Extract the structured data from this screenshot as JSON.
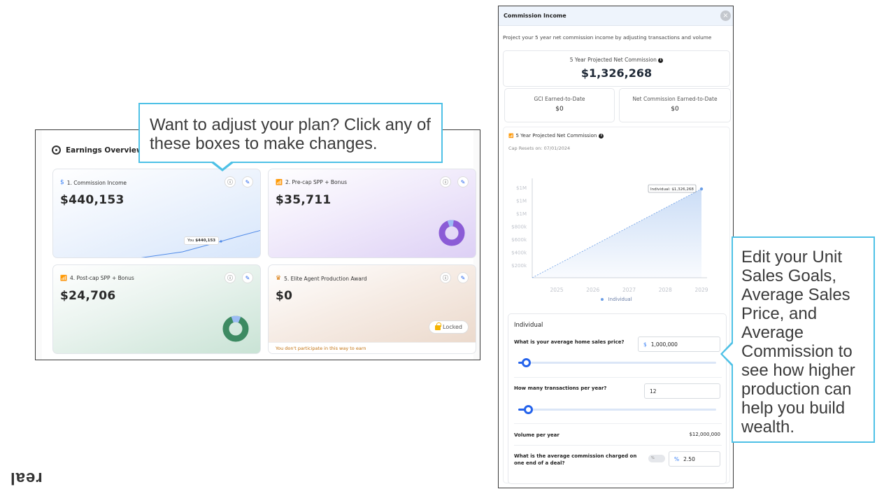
{
  "earnings": {
    "title": "Earnings Overview",
    "cards": [
      {
        "label": "1. Commission Income",
        "value": "$440,153",
        "you_label": "You",
        "you_value": "$440,153"
      },
      {
        "label": "2. Pre-cap SPP + Bonus",
        "value": "$35,711"
      },
      {
        "label": "4. Post-cap SPP + Bonus",
        "value": "$24,706"
      },
      {
        "label": "5. Elite Agent Production Award",
        "value": "$0",
        "locked_label": "Locked",
        "note": "You don't participate in this way to earn"
      }
    ],
    "donuts": [
      {
        "fill_fraction": 0.08,
        "main_color": "#8b5cd6",
        "slice_color": "#9cbcf4"
      },
      {
        "fill_fraction": 0.12,
        "main_color": "#3d8a62",
        "slice_color": "#9cbcf4"
      }
    ]
  },
  "callouts": {
    "top": "Want to adjust your plan? Click any of these boxes to make changes.",
    "right": "Edit your Unit Sales Goals, Average Sales Price, and Average Commission to see how higher production can help you build wealth."
  },
  "panel": {
    "title": "Commission Income",
    "close_icon": "×",
    "subtitle": "Project your 5 year net commission income by adjusting transactions and volume",
    "projected_label": "5 Year Projected Net Commission",
    "projected_value": "$1,326,268",
    "gci_label": "GCI Earned-to-Date",
    "gci_value": "$0",
    "net_label": "Net Commission Earned-to-Date",
    "net_value": "$0",
    "chart_title": "5 Year Projected Net Commission",
    "cap_resets": "Cap Resets on: 07/01/2024",
    "tooltip": "Individual: $1,326,268",
    "legend": "Individual",
    "individual_title": "Individual",
    "q_price": "What is your average home sales price?",
    "price_prefix": "$",
    "price_value": "1,000,000",
    "q_transactions": "How many transactions per year?",
    "transactions_value": "12",
    "volume_label": "Volume per year",
    "volume_value": "$12,000,000",
    "q_commission": "What is the average commission charged on one end of a deal?",
    "commission_toggle": "%",
    "commission_prefix": "%",
    "commission_value": "2.50",
    "price_slider_fraction": 0.04,
    "transactions_slider_fraction": 0.05
  },
  "chart_data": {
    "type": "area",
    "x": [
      "2025",
      "2026",
      "2027",
      "2028",
      "2029"
    ],
    "y_tick_labels": [
      "$200k",
      "$400k",
      "$600k",
      "$800k",
      "$1M",
      "$1M",
      "$1M"
    ],
    "series": [
      {
        "name": "Individual",
        "values": [
          0,
          331567,
          663134,
          994701,
          1326268
        ]
      }
    ],
    "ylim": [
      0,
      1400000
    ],
    "color": "#6b9ee6"
  },
  "brand": {
    "logo": "real"
  }
}
